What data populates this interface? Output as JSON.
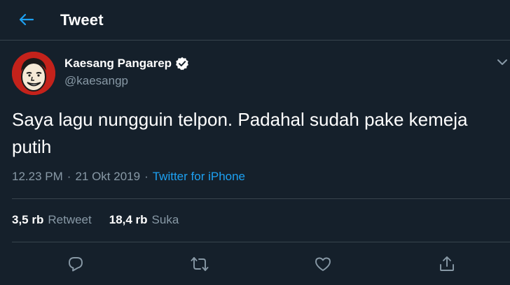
{
  "header": {
    "title": "Tweet",
    "back_icon": "arrow-left-icon"
  },
  "author": {
    "name": "Kaesang Pangarep",
    "handle": "@kaesangp",
    "verified": true
  },
  "tweet": {
    "text_line1": "Saya lagu nungguin telpon. Padahal sudah pake kemeja",
    "text_line2": "putih",
    "time": "12.23 PM",
    "date": "21 Okt 2019",
    "separator": "·",
    "source": "Twitter for iPhone"
  },
  "stats": {
    "retweets": {
      "count": "3,5 rb",
      "label": "Retweet"
    },
    "likes": {
      "count": "18,4 rb",
      "label": "Suka"
    }
  },
  "actions": [
    "reply-icon",
    "retweet-icon",
    "like-icon",
    "share-icon"
  ],
  "colors": {
    "background": "#15202b",
    "accent": "#1da1f2",
    "secondary_text": "#8899a6",
    "divider": "#38444d"
  }
}
